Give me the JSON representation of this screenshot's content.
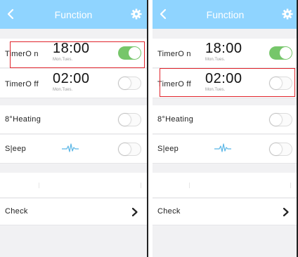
{
  "screens": [
    {
      "header": {
        "title": "Function"
      },
      "timer_on": {
        "label": "TimerO n",
        "time": "18:00",
        "days": "Mon.Tues.",
        "enabled": true
      },
      "timer_off": {
        "label": "TimerO ff",
        "time": "02:00",
        "days": "Mon.Tues.",
        "enabled": false
      },
      "heating": {
        "label": "8°Heating",
        "enabled": false
      },
      "sleep": {
        "label": "S|eep",
        "enabled": false
      },
      "check": {
        "label": "Check"
      },
      "highlighted_row": "timer-on"
    },
    {
      "header": {
        "title": "Function"
      },
      "timer_on": {
        "label": "TimerO n",
        "time": "18:00",
        "days": "Mon.Tues.",
        "enabled": true
      },
      "timer_off": {
        "label": "TimerO ff",
        "time": "02:00",
        "days": "Mon.Tues.",
        "enabled": false
      },
      "heating": {
        "label": "8°Heating",
        "enabled": false
      },
      "sleep": {
        "label": "S|eep",
        "enabled": false
      },
      "check": {
        "label": "Check"
      },
      "highlighted_row": "timer-off"
    }
  ],
  "icons": {
    "back": "chevron-left-icon",
    "settings": "gear-icon",
    "sleep": "sleep-wave-icon",
    "check": "chevron-right-icon"
  },
  "colors": {
    "header": "#8fd4ff",
    "toggle_on": "#76c66a",
    "highlight": "#e0242c",
    "background": "#f1f1f3"
  }
}
